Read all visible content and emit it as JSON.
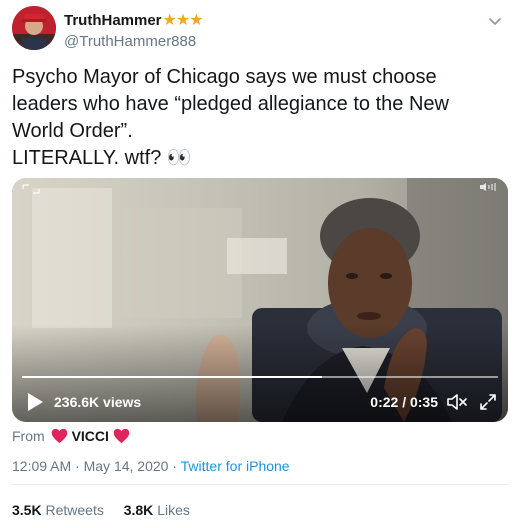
{
  "user": {
    "display_name": "TruthHammer",
    "badges": "★★★",
    "handle": "@TruthHammer888"
  },
  "tweet": {
    "text_line1": "Psycho Mayor of Chicago says we must choose",
    "text_line2": "leaders who have “pledged allegiance to the New",
    "text_line3": "World Order”.",
    "text_line4": "LITERALLY. wtf? 👀"
  },
  "video": {
    "views": "236.6K views",
    "time": "0:22 / 0:35",
    "progress": 0.63
  },
  "source": {
    "from_label": "From",
    "name": "VICCI"
  },
  "meta": {
    "time": "12:09 AM",
    "sep1": " · ",
    "date": "May 14, 2020",
    "sep2": " · ",
    "client": "Twitter for iPhone"
  },
  "stats": {
    "retweets_count": "3.5K",
    "retweets_label": "Retweets",
    "likes_count": "3.8K",
    "likes_label": "Likes"
  },
  "colors": {
    "link": "#1b95e0",
    "muted": "#657786",
    "heart": "#e0245e",
    "star": "#f5a623"
  }
}
